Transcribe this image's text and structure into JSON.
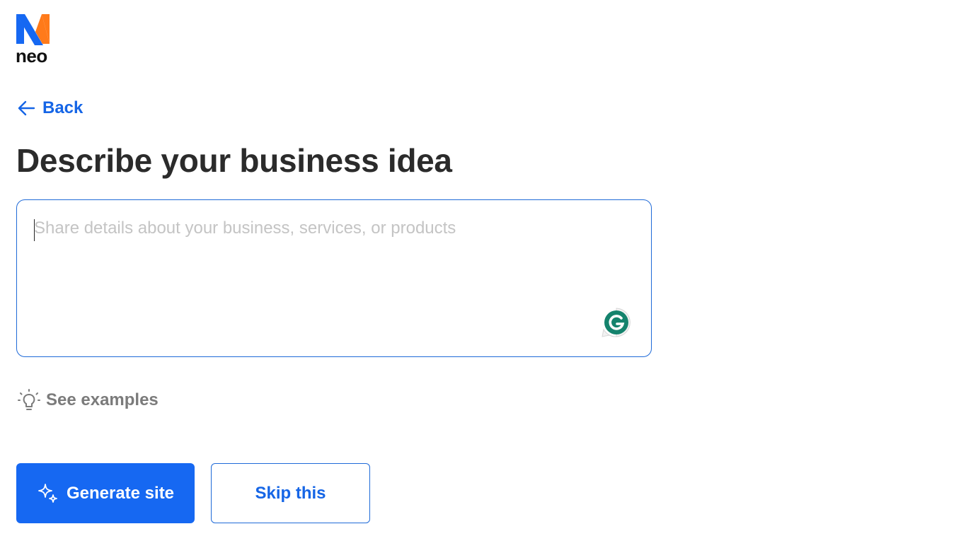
{
  "brand": {
    "logo_text": "neo",
    "logo_icon": "neo-logo-icon",
    "colors": {
      "blue": "#1668f2",
      "orange": "#ff7a1a"
    }
  },
  "nav": {
    "back_label": "Back",
    "back_icon": "arrow-left-icon"
  },
  "main": {
    "title": "Describe your business idea",
    "textarea": {
      "value": "",
      "placeholder": "Share details about your business, services, or products"
    },
    "grammarly_icon": "grammarly-icon",
    "examples_label": "See examples",
    "examples_icon": "lightbulb-icon"
  },
  "actions": {
    "generate_label": "Generate site",
    "generate_icon": "sparkle-icon",
    "skip_label": "Skip this"
  },
  "colors": {
    "accent": "#1668f2",
    "border": "#1f6ad8",
    "title": "#2b2b2b",
    "muted": "#7b7b7b",
    "grammarly": "#15836d"
  }
}
